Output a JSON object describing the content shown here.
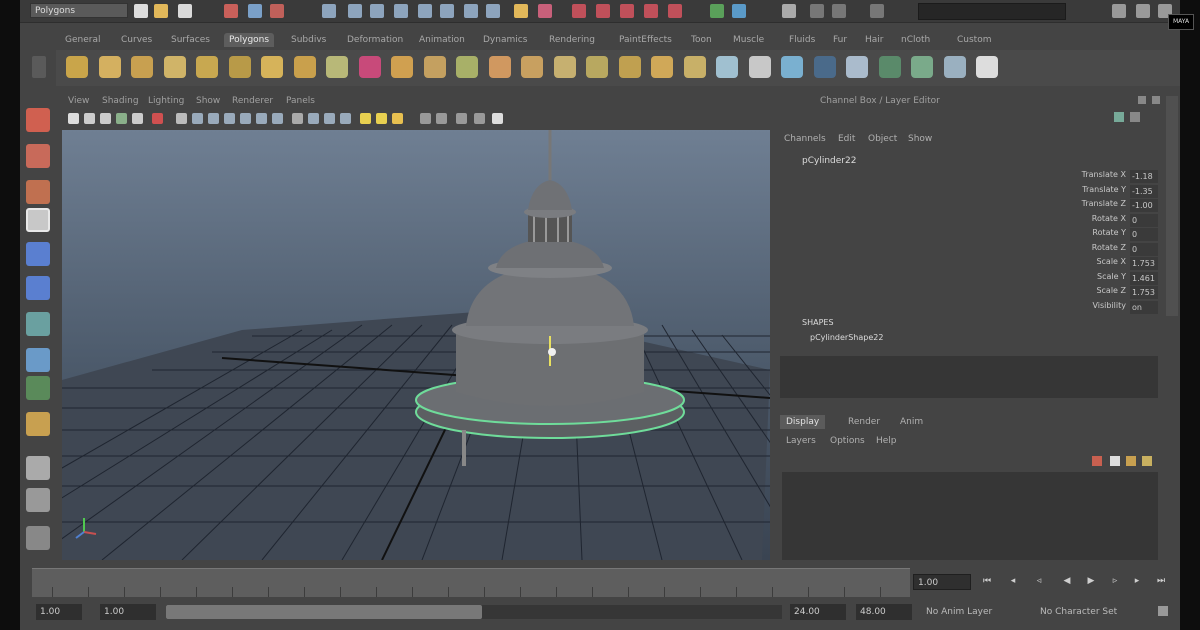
{
  "statusline": {
    "mode": "Polygons",
    "icons": [
      "new-scene-icon",
      "open-scene-icon",
      "save-scene-icon",
      "select-hierarchy-icon",
      "select-object-icon",
      "select-component-icon",
      "snap-grid-icon",
      "snap-curve-icon",
      "snap-point-icon",
      "snap-plane-icon",
      "render-frame-icon",
      "ipr-render-icon",
      "render-settings-icon",
      "hypershade-icon"
    ]
  },
  "shelf_tabs": [
    "General",
    "Curves",
    "Surfaces",
    "Polygons",
    "Subdivs",
    "Deformation",
    "Animation",
    "Dynamics",
    "Rendering",
    "PaintEffects",
    "Toon",
    "Muscle",
    "Fluids",
    "Fur",
    "Hair",
    "nCloth",
    "Custom"
  ],
  "shelf_active_index": 3,
  "shelf_icons": [
    "poly-sphere-icon",
    "poly-cube-icon",
    "poly-cylinder-icon",
    "poly-cone-icon",
    "poly-plane-icon",
    "poly-torus-icon",
    "poly-prism-icon",
    "poly-pyramid-icon",
    "poly-pipe-icon",
    "combine-icon",
    "separate-icon",
    "extract-icon",
    "booleans-icon",
    "smooth-icon",
    "reduce-icon",
    "cleanup-icon",
    "mirror-icon",
    "fill-hole-icon",
    "make-hole-icon",
    "append-polygon-icon",
    "split-polygon-icon",
    "insert-edgeloop-icon",
    "offset-edgeloop-icon",
    "extrude-icon",
    "bridge-icon",
    "bevel-icon",
    "merge-icon",
    "collapse-icon",
    "delete-edge-icon",
    "wedge-icon",
    "chamfer-icon",
    "crease-icon",
    "duplicate-face-icon"
  ],
  "panel_menu": [
    "View",
    "Shading",
    "Lighting",
    "Show",
    "Renderer",
    "Panels"
  ],
  "channel_box": {
    "title": "Channel Box / Layer Editor",
    "menu": [
      "Channels",
      "Edit",
      "Object",
      "Show"
    ],
    "object_name": "pCylinder22",
    "attributes": [
      {
        "label": "Translate X",
        "value": "-1.18"
      },
      {
        "label": "Translate Y",
        "value": "-1.35"
      },
      {
        "label": "Translate Z",
        "value": "-1.00"
      },
      {
        "label": "Rotate X",
        "value": "0"
      },
      {
        "label": "Rotate Y",
        "value": "0"
      },
      {
        "label": "Rotate Z",
        "value": "0"
      },
      {
        "label": "Scale X",
        "value": "1.753"
      },
      {
        "label": "Scale Y",
        "value": "1.461"
      },
      {
        "label": "Scale Z",
        "value": "1.753"
      },
      {
        "label": "Visibility",
        "value": "on"
      }
    ],
    "shapes_label": "SHAPES",
    "shape_name": "pCylinderShape22"
  },
  "layer_editor": {
    "tabs": [
      "Display",
      "Render",
      "Anim"
    ],
    "active_tab_index": 0,
    "menu": [
      "Layers",
      "Options",
      "Help"
    ]
  },
  "time_slider": {
    "current_time": "1.00",
    "range_start": "1.00",
    "range_in": "1.00",
    "range_out": "24.00",
    "range_end": "48.00",
    "anim_layer": "No Anim Layer",
    "character_set": "No Character Set"
  },
  "watermark": "MAYA"
}
